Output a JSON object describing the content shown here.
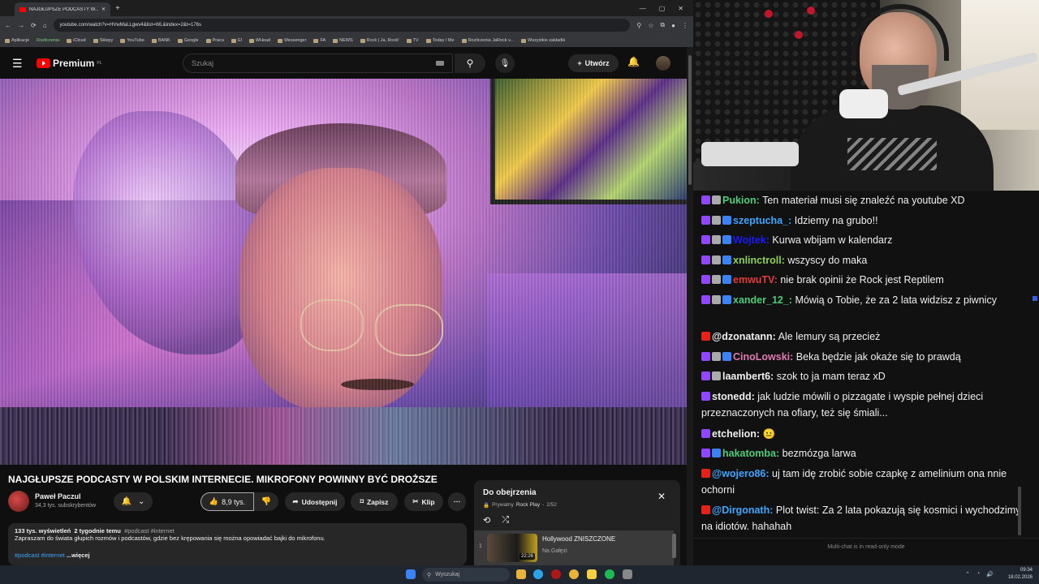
{
  "browser": {
    "tab_title": "NAJGŁUPSZE PODCASTY W...",
    "url": "youtube.com/watch?v=HVwMaLLgwv4&list=WL&index=2&t=176s",
    "bookmarks": [
      "Aplikacje",
      "Rozliczenia",
      "iCloud",
      "Sklepy",
      "YouTube",
      "BANK",
      "Google",
      "Praca",
      "El",
      "WHead",
      "Messenger",
      "FA",
      "NEWS",
      "Rock | Ja, Rock!",
      "TV",
      "Today / Me",
      "Rozliczenia JaRock v...",
      "Wszystkie zakładki"
    ]
  },
  "youtube": {
    "logo_text": "Premium",
    "logo_region": "PL",
    "search_placeholder": "Szukaj",
    "create_label": "Utwórz",
    "video_title": "NAJGŁUPSZE PODCASTY W POLSKIM INTERNECIE. MIKROFONY POWINNY BYĆ DROŻSZE",
    "channel_name": "Paweł Paczul",
    "subscribers": "34,3 tys. subskrybentów",
    "likes": "8,9 tys.",
    "share_label": "Udostępnij",
    "save_label": "Zapisz",
    "clip_label": "Klip",
    "description": {
      "views": "133 tys. wyświetleń",
      "age": "2 tygodnie temu",
      "tags_meta": "#podcast #internet",
      "text": "Zapraszam do świata głupich rozmów i podcastów, gdzie bez krępowania się można opowiadać bajki do mikrofonu.",
      "tags": "#podcast #internet",
      "more": "...więcej"
    },
    "playlist": {
      "title": "Do obejrzenia",
      "privacy": "Prywatny",
      "owner": "Rock Play",
      "position": "2/52",
      "item_number": "1",
      "item_title": "Hollywood ZNISZCZONE",
      "item_channel": "Na Gałęzi",
      "item_duration": "22:26"
    }
  },
  "chat": {
    "messages": [
      {
        "platform": "twitch",
        "user": "Pukion:",
        "text": "Ten materiał musi się znaleźć na youtube XD",
        "color": "#4ecb7a"
      },
      {
        "platform": "twitch",
        "user": "szeptucha_:",
        "text": "Idziemy na grubo!!",
        "color": "#3ea6ff"
      },
      {
        "platform": "twitch",
        "user": "Wojtek:",
        "text": "Kurwa wbijam w kalendarz",
        "color": "#1a1aff"
      },
      {
        "platform": "twitch",
        "user": "xnlinctroll:",
        "text": "wszyscy do maka",
        "color": "#8fd14f"
      },
      {
        "platform": "twitch",
        "user": "emwuTV:",
        "text": "nie brak opinii że Rock jest Reptilem",
        "color": "#e23b3b"
      },
      {
        "platform": "twitch",
        "user": "xander_12_:",
        "text": "Mówią o Tobie, że za 2 lata widzisz z piwnicy",
        "color": "#4ecb7a"
      },
      {
        "platform": "youtube",
        "user": "@dzonatann:",
        "text": "Ale lemury są przecież",
        "color": "#efeff1"
      },
      {
        "platform": "twitch",
        "user": "CinoLowski:",
        "text": "Beka będzie jak okaże się to prawdą",
        "color": "#e07ab5"
      },
      {
        "platform": "twitch",
        "user": "laambert6:",
        "text": "szok to ja mam teraz xD",
        "color": "#efeff1"
      },
      {
        "platform": "twitch",
        "user": "stonedd:",
        "text": "jak ludzie mówili o pizzagate i wyspie pełnej dzieci przeznaczonych na ofiary, też się śmiali...",
        "color": "#efeff1"
      },
      {
        "platform": "twitch",
        "user": "etchelion:",
        "text": "😐",
        "color": "#efeff1"
      },
      {
        "platform": "twitch",
        "user": "hakatomba:",
        "text": "bezmózga larwa",
        "color": "#4ecb7a"
      },
      {
        "platform": "youtube",
        "user": "@wojero86:",
        "text": "uj tam idę zrobić sobie czapkę z amelinium ona nnie ochorni",
        "color": "#3ea6ff"
      },
      {
        "platform": "youtube",
        "user": "@Dirgonath:",
        "text": "Plot twist: Za 2 lata pokazują się kosmici i wychodzimy na idiotów. hahahah",
        "color": "#3ea6ff"
      }
    ],
    "footer": "Multi-chat is in read-only mode"
  },
  "taskbar": {
    "search_label": "Wyszukaj",
    "time": "09:34",
    "date": "18.02.2026"
  },
  "icons": {
    "menu": "menu-icon",
    "search": "search-icon",
    "mic": "mic-icon",
    "bell": "bell-icon",
    "like": "thumbs-up-icon",
    "dislike": "thumbs-down-icon",
    "share": "share-icon",
    "save": "bookmark-icon",
    "clip": "scissors-icon",
    "more": "more-icon",
    "close": "close-icon",
    "loop": "loop-icon",
    "shuffle": "shuffle-icon"
  }
}
